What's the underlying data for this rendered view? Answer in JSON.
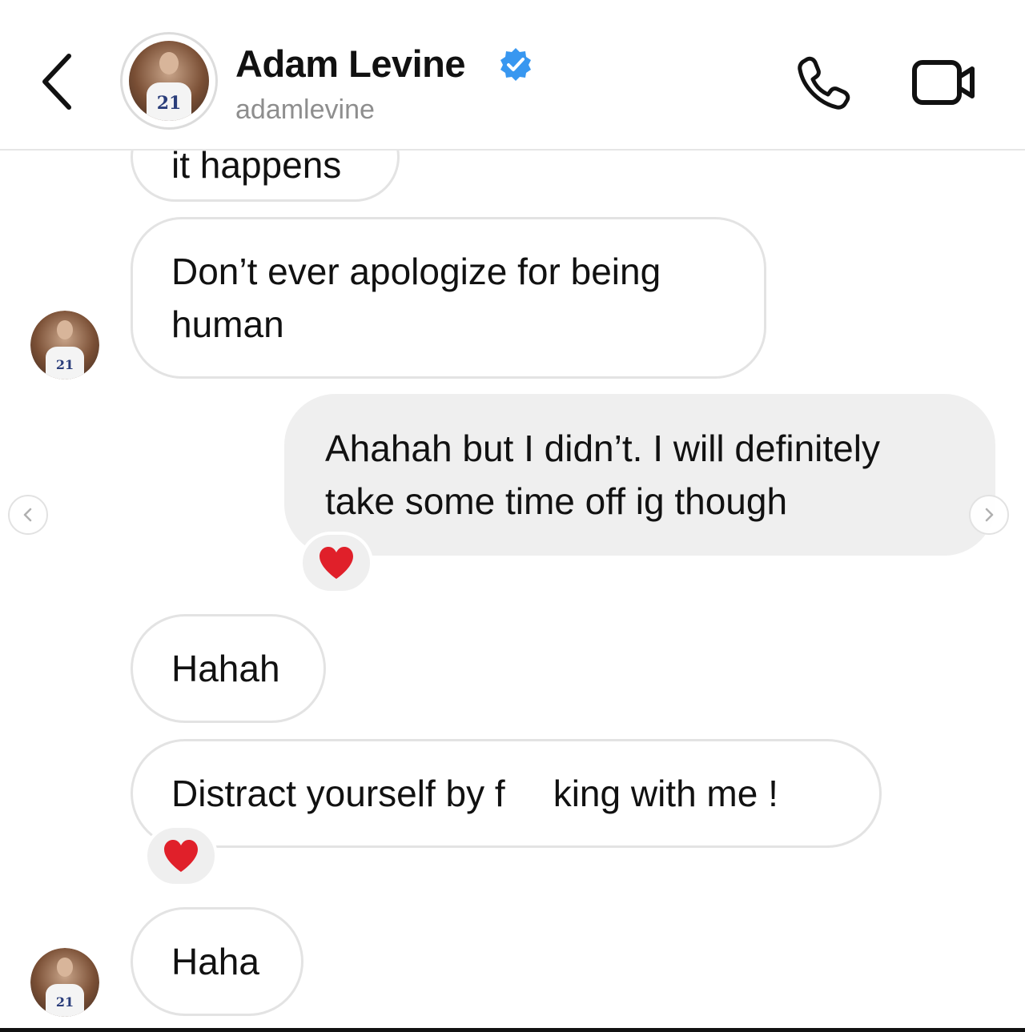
{
  "header": {
    "name": "Adam Levine",
    "username": "adamlevine",
    "jersey_number": "21"
  },
  "messages": [
    {
      "from": "them",
      "text": "it happens"
    },
    {
      "from": "them",
      "lines": [
        "Don’t ever apologize for being",
        "human"
      ]
    },
    {
      "from": "me",
      "lines": [
        "Ahahah but I didn’t. I will definitely",
        "take some time off ig though"
      ],
      "reaction": "heart"
    },
    {
      "from": "them",
      "text": "Hahah"
    },
    {
      "from": "them",
      "text_a": "Distract yourself by f",
      "text_b": "king with me !",
      "reaction": "heart"
    },
    {
      "from": "them",
      "text": "Haha"
    }
  ],
  "colors": {
    "verified": "#3897f0",
    "heart": "#e0202a",
    "sent_bubble": "#efefef",
    "received_border": "#e3e3e3"
  },
  "icons": {
    "back": "chevron-left-icon",
    "call": "phone-icon",
    "video": "video-camera-icon",
    "verified": "verified-badge-icon",
    "reaction": "red-heart-icon"
  }
}
